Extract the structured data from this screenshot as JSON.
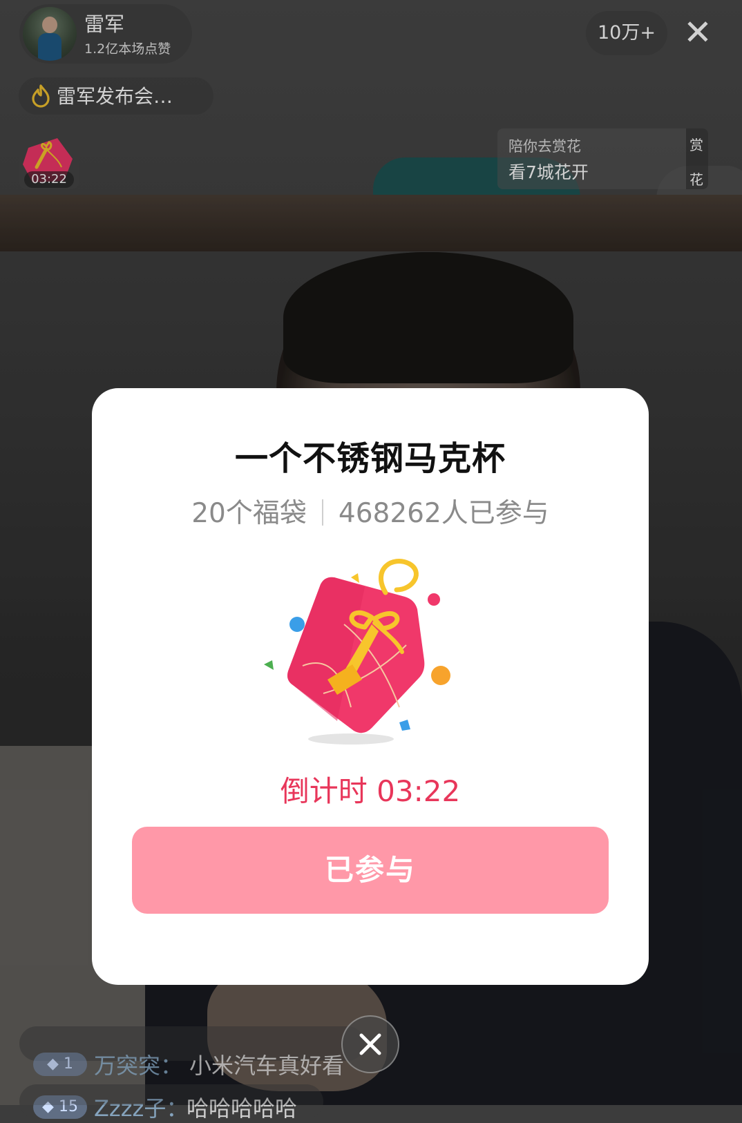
{
  "host": {
    "name": "雷军",
    "likes": "1.2亿本场点赞"
  },
  "viewers": "10万+",
  "topic": "雷军发布会…",
  "lucky_bag_thumb": {
    "time": "03:22"
  },
  "promo": {
    "subtitle": "陪你去赏花",
    "title": "看7城花开",
    "side_chars": [
      "赏",
      "花"
    ]
  },
  "modal": {
    "title": "一个不锈钢马克杯",
    "bag_count": "20个福袋",
    "participants": "468262人已参与",
    "countdown": "倒计时 03:22",
    "button_label": "已参与"
  },
  "chat": [
    {
      "level": "1",
      "user": "万突突：",
      "message": "小米汽车真好看"
    },
    {
      "level": "15",
      "user": "Zzzz子：",
      "message": "哈哈哈哈哈"
    }
  ],
  "colors": {
    "accent_red": "#e8365a",
    "button_pink": "#ff98a8",
    "bag_pink": "#f0386a",
    "bag_gold": "#f7c52c"
  },
  "icons": {
    "top_close": "close-icon",
    "modal_close": "close-icon",
    "topic": "fire-icon"
  }
}
